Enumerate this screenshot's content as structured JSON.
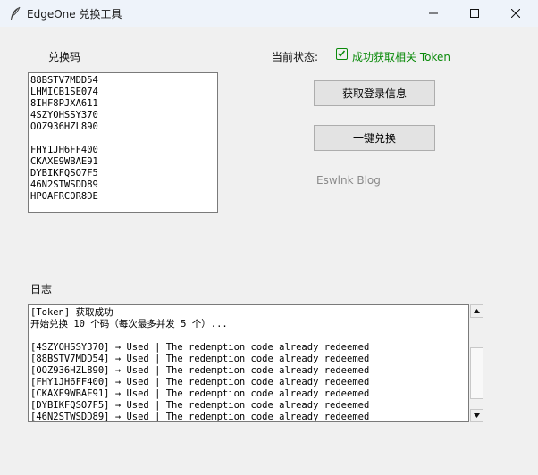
{
  "window": {
    "title": "EdgeOne 兑换工具"
  },
  "codes_section": {
    "label": "兑换码",
    "lines": [
      "88BSTV7MDD54",
      "LHMICB1SE074",
      "8IHF8PJXA611",
      "4SZYOHSSY370",
      "OOZ936HZL890",
      "",
      "FHY1JH6FF400",
      "CKAXE9WBAE91",
      "DYBIKFQSO7F5",
      "46N2STWSDD89",
      "HPOAFRCOR8DE"
    ]
  },
  "status": {
    "label": "当前状态:",
    "value": "成功获取相关 Token",
    "color": "#0a8a0a"
  },
  "buttons": {
    "get_login": "获取登录信息",
    "redeem_all": "一键兑换"
  },
  "blog_link": "Eswlnk Blog",
  "log_section": {
    "label": "日志",
    "lines": [
      "[Token] 获取成功",
      "开始兑换 10 个码（每次最多并发 5 个）...",
      "",
      "[4SZYOHSSY370] → Used | The redemption code already redeemed",
      "[88BSTV7MDD54] → Used | The redemption code already redeemed",
      "[OOZ936HZL890] → Used | The redemption code already redeemed",
      "[FHY1JH6FF400] → Used | The redemption code already redeemed",
      "[CKAXE9WBAE91] → Used | The redemption code already redeemed",
      "[DYBIKFQSO7F5] → Used | The redemption code already redeemed",
      "[46N2STWSDD89] → Used | The redemption code already redeemed"
    ]
  },
  "icons": {
    "app": "feather-icon",
    "minimize": "minimize-icon",
    "maximize": "maximize-icon",
    "close": "close-icon",
    "status": "checkbox-checked-icon",
    "scroll_up": "scroll-up-arrow-icon",
    "scroll_down": "scroll-down-arrow-icon"
  }
}
